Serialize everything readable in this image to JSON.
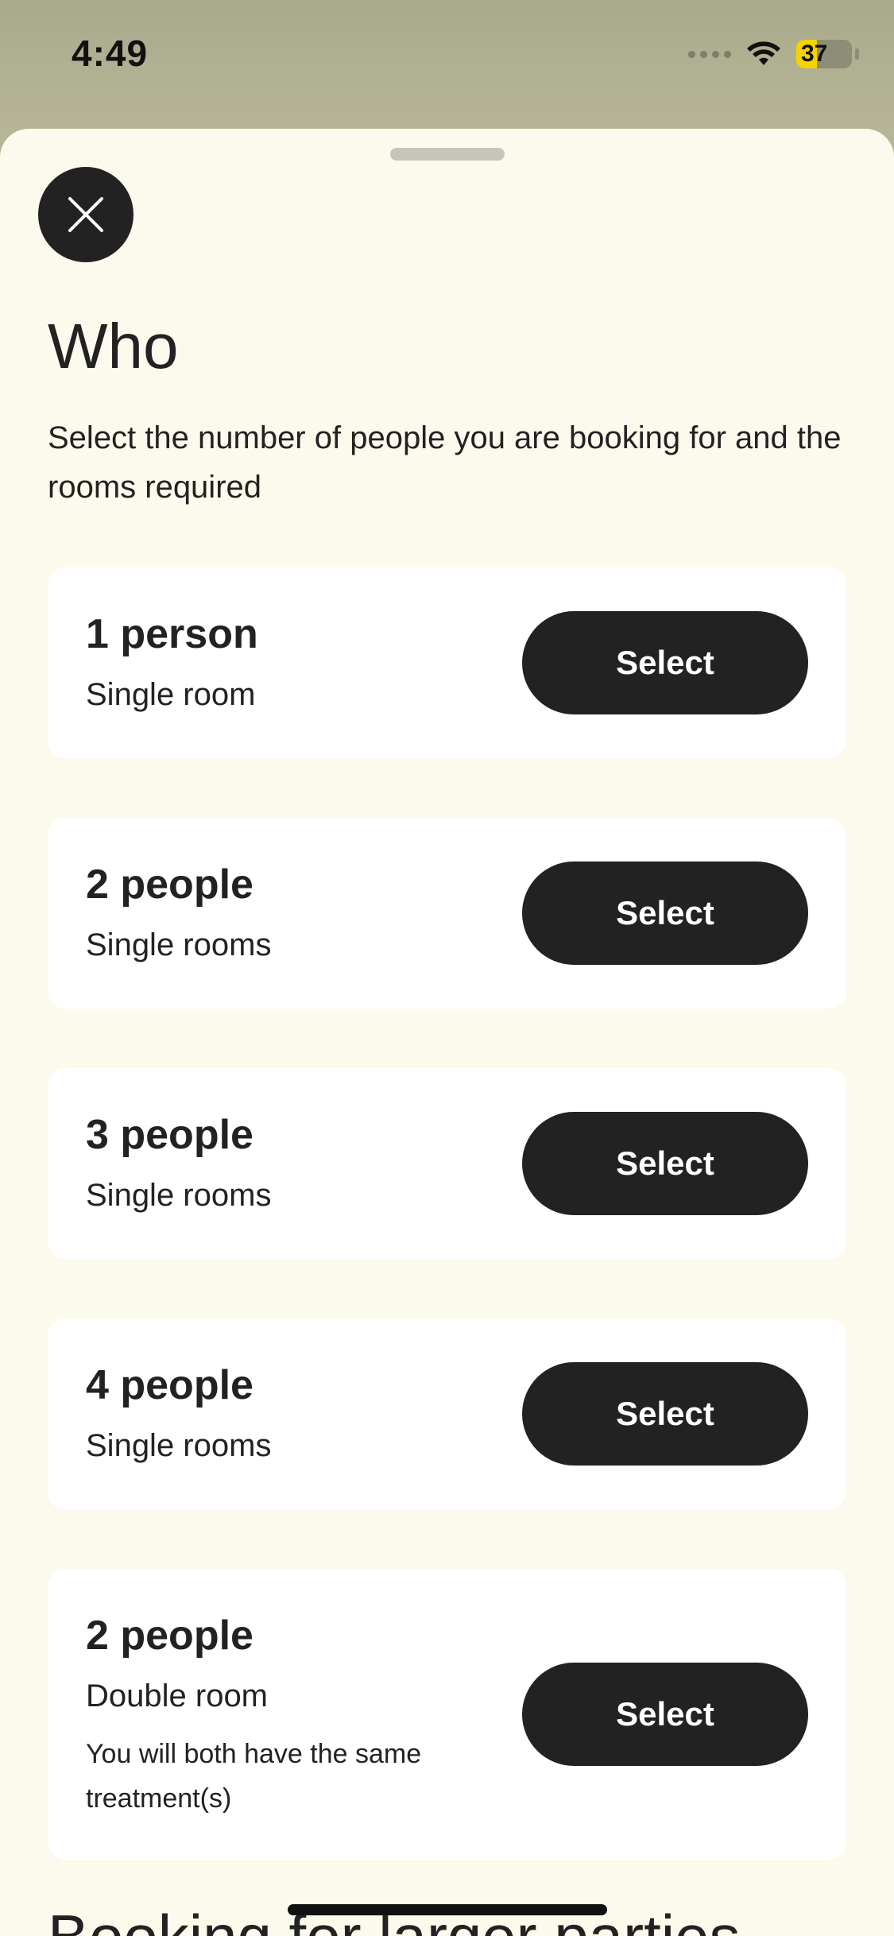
{
  "status_bar": {
    "time": "4:49",
    "battery_level": "37",
    "battery_fraction": 0.37,
    "battery_color": "#f5d300"
  },
  "sheet": {
    "close_icon": "close-icon",
    "title": "Who",
    "subtitle": "Select the number of people you are booking for and the rooms required",
    "options": [
      {
        "title": "1 person",
        "subtitle": "Single room",
        "note": "",
        "button": "Select"
      },
      {
        "title": "2 people",
        "subtitle": "Single rooms",
        "note": "",
        "button": "Select"
      },
      {
        "title": "3 people",
        "subtitle": "Single rooms",
        "note": "",
        "button": "Select"
      },
      {
        "title": "4 people",
        "subtitle": "Single rooms",
        "note": "",
        "button": "Select"
      },
      {
        "title": "2 people",
        "subtitle": "Double room",
        "note": "You will both have the same treatment(s)",
        "button": "Select"
      }
    ],
    "next_section_heading": "Booking for larger parties"
  },
  "colors": {
    "sheet_background": "#fcfaed",
    "card_background": "#ffffff",
    "button_background": "#222222",
    "text": "#222222"
  }
}
